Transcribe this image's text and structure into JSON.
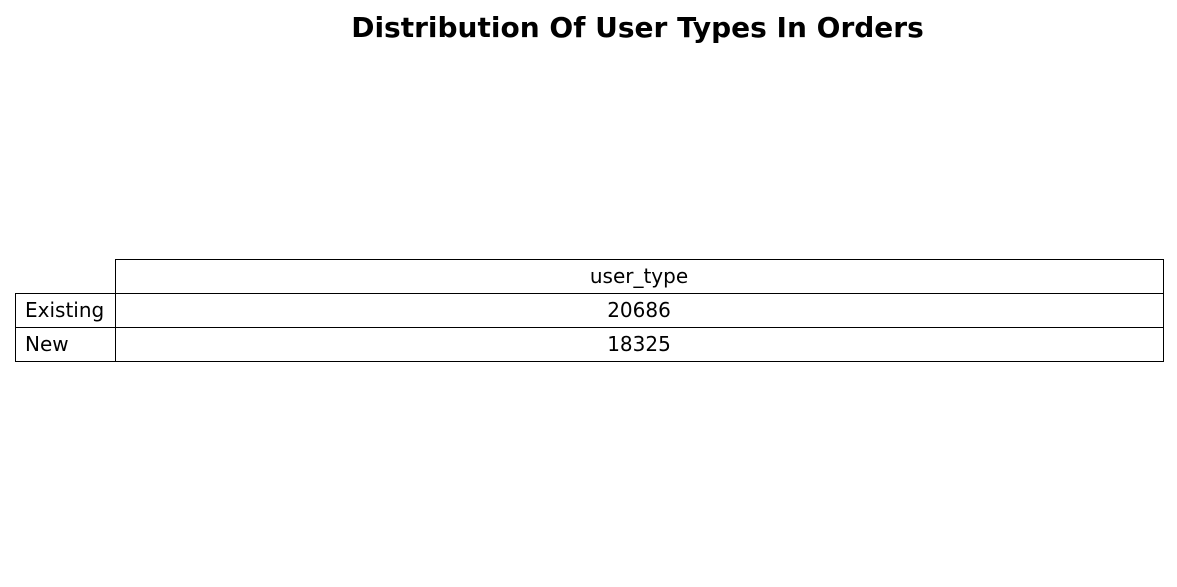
{
  "chart_data": {
    "type": "table",
    "title": "Distribution Of User Types In Orders",
    "columns": [
      "user_type"
    ],
    "rows": [
      {
        "label": "Existing",
        "values": [
          "20686"
        ]
      },
      {
        "label": "New",
        "values": [
          "18325"
        ]
      }
    ]
  }
}
